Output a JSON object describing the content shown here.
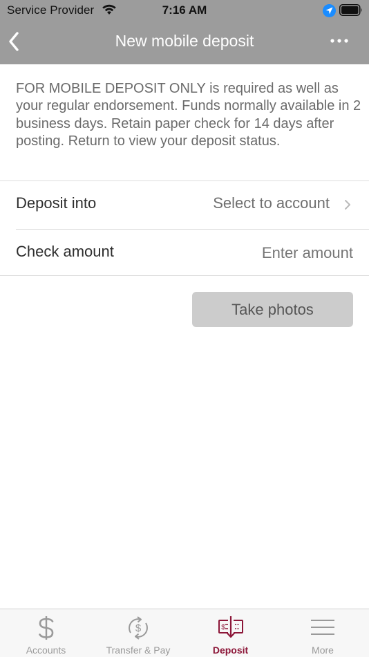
{
  "status_bar": {
    "carrier": "Service Provider",
    "time": "7:16 AM"
  },
  "nav": {
    "title": "New mobile deposit",
    "back_icon": "chevron-left-icon",
    "more_icon": "more-dots-icon"
  },
  "notice": "FOR MOBILE DEPOSIT ONLY is required as well as your regular endorsement. Funds normally available in 2 business days. Retain paper check for 14 days after posting. Return to view your deposit status.",
  "form": {
    "deposit_into": {
      "label": "Deposit into",
      "value": "Select to account"
    },
    "check_amount": {
      "label": "Check amount",
      "placeholder": "Enter amount"
    }
  },
  "actions": {
    "take_photos": "Take photos"
  },
  "tab_bar": {
    "active": "Deposit",
    "tabs": [
      {
        "label": "Accounts",
        "icon": "dollar-icon"
      },
      {
        "label": "Transfer & Pay",
        "icon": "transfer-icon"
      },
      {
        "label": "Deposit",
        "icon": "deposit-check-icon"
      },
      {
        "label": "More",
        "icon": "menu-icon"
      }
    ]
  },
  "colors": {
    "header_bg": "#9c9c9c",
    "accent": "#8c1638",
    "button_bg": "#cccccc",
    "location_blue": "#1a8cff"
  }
}
